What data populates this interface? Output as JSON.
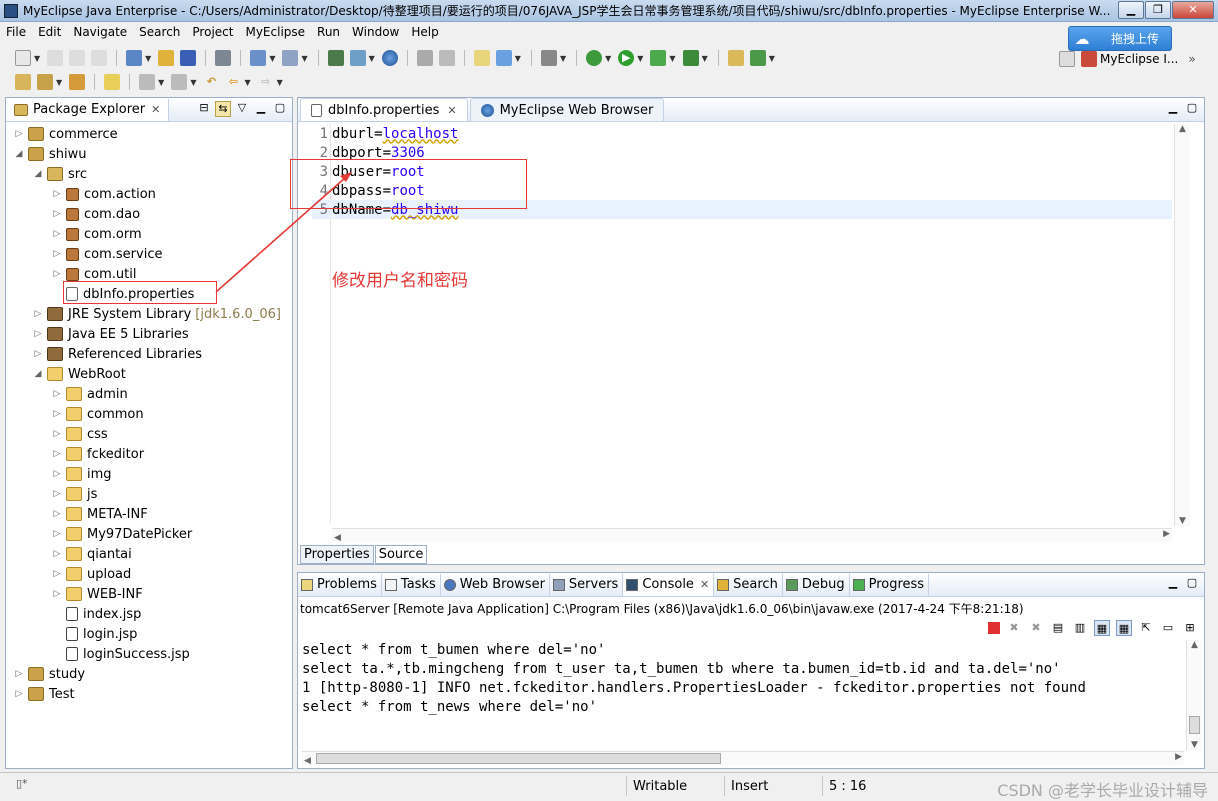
{
  "window": {
    "title": "MyEclipse Java Enterprise - C:/Users/Administrator/Desktop/待整理项目/要运行的项目/076JAVA_JSP学生会日常事务管理系统/项目代码/shiwu/src/dbInfo.properties - MyEclipse Enterprise W..."
  },
  "menubar": {
    "items": [
      "File",
      "Edit",
      "Navigate",
      "Search",
      "Project",
      "MyEclipse",
      "Run",
      "Window",
      "Help"
    ]
  },
  "upload_button": {
    "label": "拖拽上传"
  },
  "perspective": {
    "label": "MyEclipse I..."
  },
  "package_explorer": {
    "tab_label": "Package Explorer",
    "rows": [
      {
        "label": "commerce",
        "indent": 0,
        "toggle": "▷",
        "icon": "project"
      },
      {
        "label": "shiwu",
        "indent": 0,
        "toggle": "◢",
        "icon": "project"
      },
      {
        "label": "src",
        "indent": 1,
        "toggle": "◢",
        "icon": "src"
      },
      {
        "label": "com.action",
        "indent": 2,
        "toggle": "▷",
        "icon": "pkg"
      },
      {
        "label": "com.dao",
        "indent": 2,
        "toggle": "▷",
        "icon": "pkg"
      },
      {
        "label": "com.orm",
        "indent": 2,
        "toggle": "▷",
        "icon": "pkg"
      },
      {
        "label": "com.service",
        "indent": 2,
        "toggle": "▷",
        "icon": "pkg"
      },
      {
        "label": "com.util",
        "indent": 2,
        "toggle": "▷",
        "icon": "pkg"
      },
      {
        "label": "dbInfo.properties",
        "indent": 2,
        "toggle": "",
        "icon": "file"
      },
      {
        "label": "JRE System Library",
        "suffix": "[jdk1.6.0_06]",
        "indent": 1,
        "toggle": "▷",
        "icon": "lib"
      },
      {
        "label": "Java EE 5 Libraries",
        "indent": 1,
        "toggle": "▷",
        "icon": "lib"
      },
      {
        "label": "Referenced Libraries",
        "indent": 1,
        "toggle": "▷",
        "icon": "lib"
      },
      {
        "label": "WebRoot",
        "indent": 1,
        "toggle": "◢",
        "icon": "folder"
      },
      {
        "label": "admin",
        "indent": 2,
        "toggle": "▷",
        "icon": "folder"
      },
      {
        "label": "common",
        "indent": 2,
        "toggle": "▷",
        "icon": "folder"
      },
      {
        "label": "css",
        "indent": 2,
        "toggle": "▷",
        "icon": "folder"
      },
      {
        "label": "fckeditor",
        "indent": 2,
        "toggle": "▷",
        "icon": "folder"
      },
      {
        "label": "img",
        "indent": 2,
        "toggle": "▷",
        "icon": "folder"
      },
      {
        "label": "js",
        "indent": 2,
        "toggle": "▷",
        "icon": "folder"
      },
      {
        "label": "META-INF",
        "indent": 2,
        "toggle": "▷",
        "icon": "folder"
      },
      {
        "label": "My97DatePicker",
        "indent": 2,
        "toggle": "▷",
        "icon": "folder"
      },
      {
        "label": "qiantai",
        "indent": 2,
        "toggle": "▷",
        "icon": "folder"
      },
      {
        "label": "upload",
        "indent": 2,
        "toggle": "▷",
        "icon": "folder"
      },
      {
        "label": "WEB-INF",
        "indent": 2,
        "toggle": "▷",
        "icon": "folder"
      },
      {
        "label": "index.jsp",
        "indent": 2,
        "toggle": "",
        "icon": "jsp"
      },
      {
        "label": "login.jsp",
        "indent": 2,
        "toggle": "",
        "icon": "jsp"
      },
      {
        "label": "loginSuccess.jsp",
        "indent": 2,
        "toggle": "",
        "icon": "jsp"
      },
      {
        "label": "study",
        "indent": 0,
        "toggle": "▷",
        "icon": "project"
      },
      {
        "label": "Test",
        "indent": 0,
        "toggle": "▷",
        "icon": "project"
      }
    ]
  },
  "editor": {
    "tabs": [
      "dbInfo.properties",
      "MyEclipse Web Browser"
    ],
    "lines": [
      {
        "num": "1",
        "key": "dburl=",
        "value": "localhost"
      },
      {
        "num": "2",
        "key": "dbport=",
        "value": "3306"
      },
      {
        "num": "3",
        "key": "dbuser=",
        "value": "root"
      },
      {
        "num": "4",
        "key": "dbpass=",
        "value": "root"
      },
      {
        "num": "5",
        "key": "dbName=",
        "value": "db_shiwu"
      }
    ],
    "annotation": "修改用户名和密码",
    "bottom_tabs": [
      "Properties",
      "Source"
    ]
  },
  "console": {
    "tabs": [
      "Problems",
      "Tasks",
      "Web Browser",
      "Servers",
      "Console",
      "Search",
      "Debug",
      "Progress"
    ],
    "description": "tomcat6Server [Remote Java Application] C:\\Program Files (x86)\\Java\\jdk1.6.0_06\\bin\\javaw.exe (2017-4-24 下午8:21:18)",
    "output": [
      "select * from t_bumen where del='no'",
      "select ta.*,tb.mingcheng from t_user ta,t_bumen tb where ta.bumen_id=tb.id and ta.del='no'",
      "1 [http-8080-1] INFO net.fckeditor.handlers.PropertiesLoader - fckeditor.properties not found",
      "select * from t_news where del='no'"
    ]
  },
  "statusbar": {
    "writable": "Writable",
    "insert": "Insert",
    "position": "5 : 16",
    "watermark": "CSDN @老学长毕业设计辅导"
  }
}
